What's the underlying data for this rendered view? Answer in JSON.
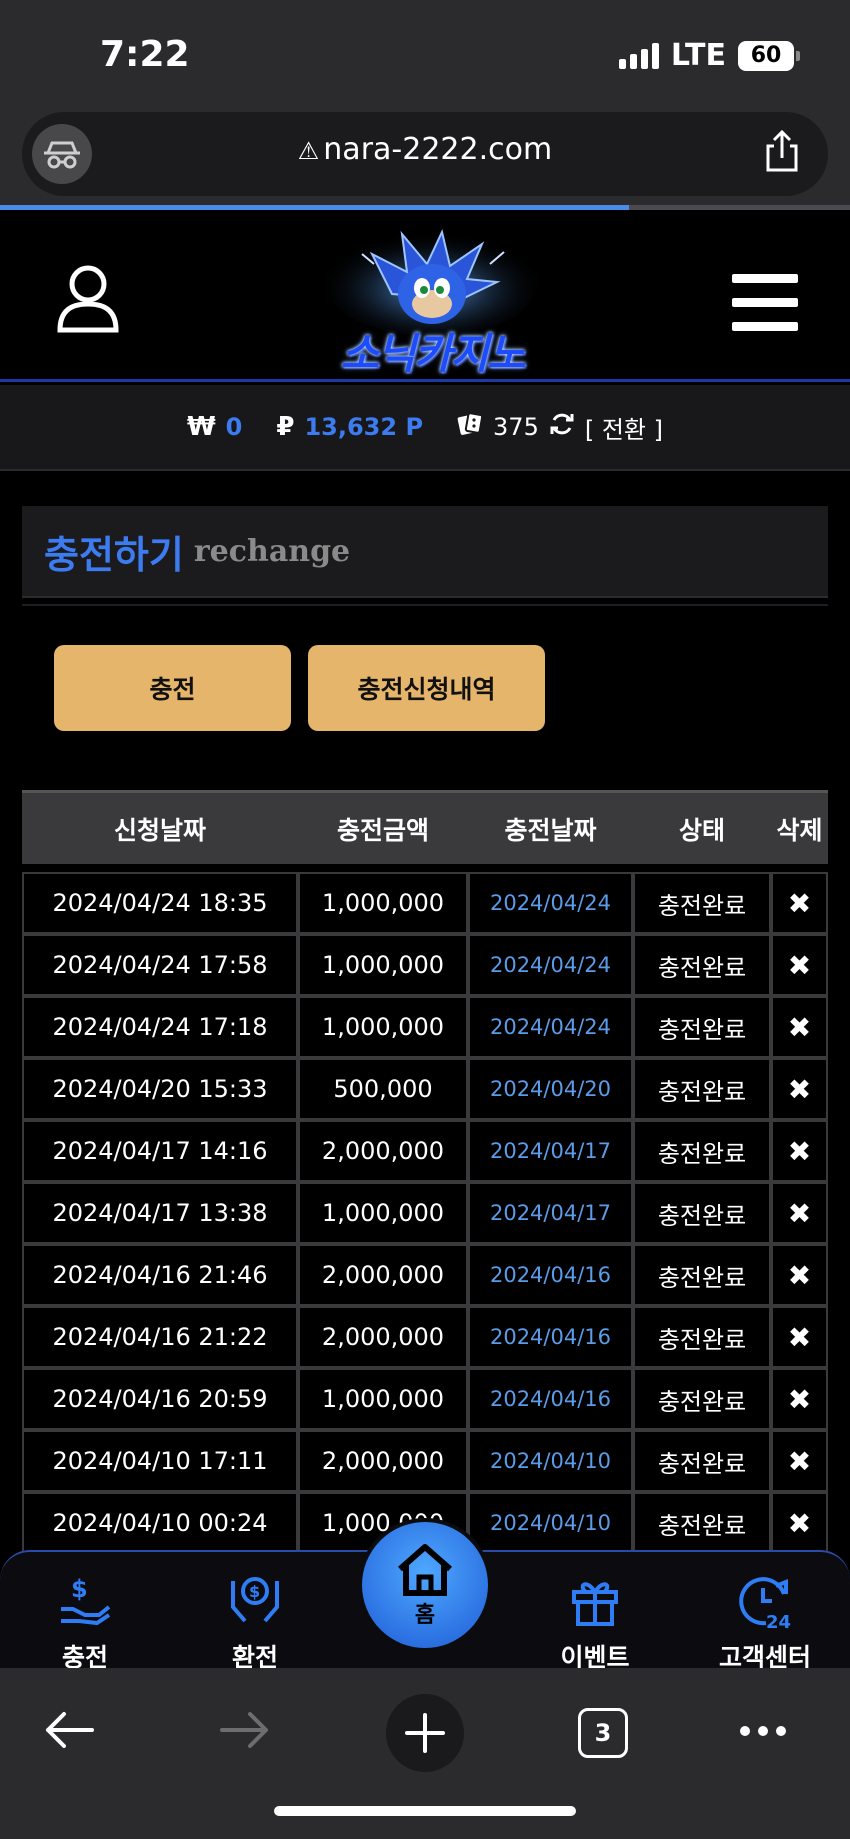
{
  "status_bar": {
    "time": "7:22",
    "network": "LTE",
    "battery": "60"
  },
  "browser": {
    "url": "nara-2222.com",
    "tab_count": "3",
    "load_progress": 0.74
  },
  "site": {
    "logo_text": "소닉카지노"
  },
  "wallet": {
    "won_symbol": "₩",
    "won_value": "0",
    "point_symbol": "₽",
    "point_value": "13,632 P",
    "chip_value": "375",
    "switch_label": "[ 전환 ]"
  },
  "page": {
    "title_ko": "충전하기",
    "title_en": "rechange"
  },
  "buttons": {
    "charge": "충전",
    "history": "충전신청내역"
  },
  "table": {
    "headers": [
      "신청날짜",
      "충전금액",
      "충전날짜",
      "상태",
      "삭제"
    ],
    "rows": [
      [
        "2024/04/24 18:35",
        "1,000,000",
        "2024/04/24",
        "충전완료",
        "✖"
      ],
      [
        "2024/04/24 17:58",
        "1,000,000",
        "2024/04/24",
        "충전완료",
        "✖"
      ],
      [
        "2024/04/24 17:18",
        "1,000,000",
        "2024/04/24",
        "충전완료",
        "✖"
      ],
      [
        "2024/04/20 15:33",
        "500,000",
        "2024/04/20",
        "충전완료",
        "✖"
      ],
      [
        "2024/04/17 14:16",
        "2,000,000",
        "2024/04/17",
        "충전완료",
        "✖"
      ],
      [
        "2024/04/17 13:38",
        "1,000,000",
        "2024/04/17",
        "충전완료",
        "✖"
      ],
      [
        "2024/04/16 21:46",
        "2,000,000",
        "2024/04/16",
        "충전완료",
        "✖"
      ],
      [
        "2024/04/16 21:22",
        "2,000,000",
        "2024/04/16",
        "충전완료",
        "✖"
      ],
      [
        "2024/04/16 20:59",
        "1,000,000",
        "2024/04/16",
        "충전완료",
        "✖"
      ],
      [
        "2024/04/10 17:11",
        "2,000,000",
        "2024/04/10",
        "충전완료",
        "✖"
      ],
      [
        "2024/04/10 00:24",
        "1,000,000",
        "2024/04/10",
        "충전완료",
        "✖"
      ]
    ]
  },
  "bottom_nav": {
    "charge": "충전",
    "exchange": "환전",
    "home": "홈",
    "event": "이벤트",
    "support": "고객센터"
  },
  "colors": {
    "accent_blue": "#3c7cf0",
    "gold_button": "#e5b56c"
  }
}
